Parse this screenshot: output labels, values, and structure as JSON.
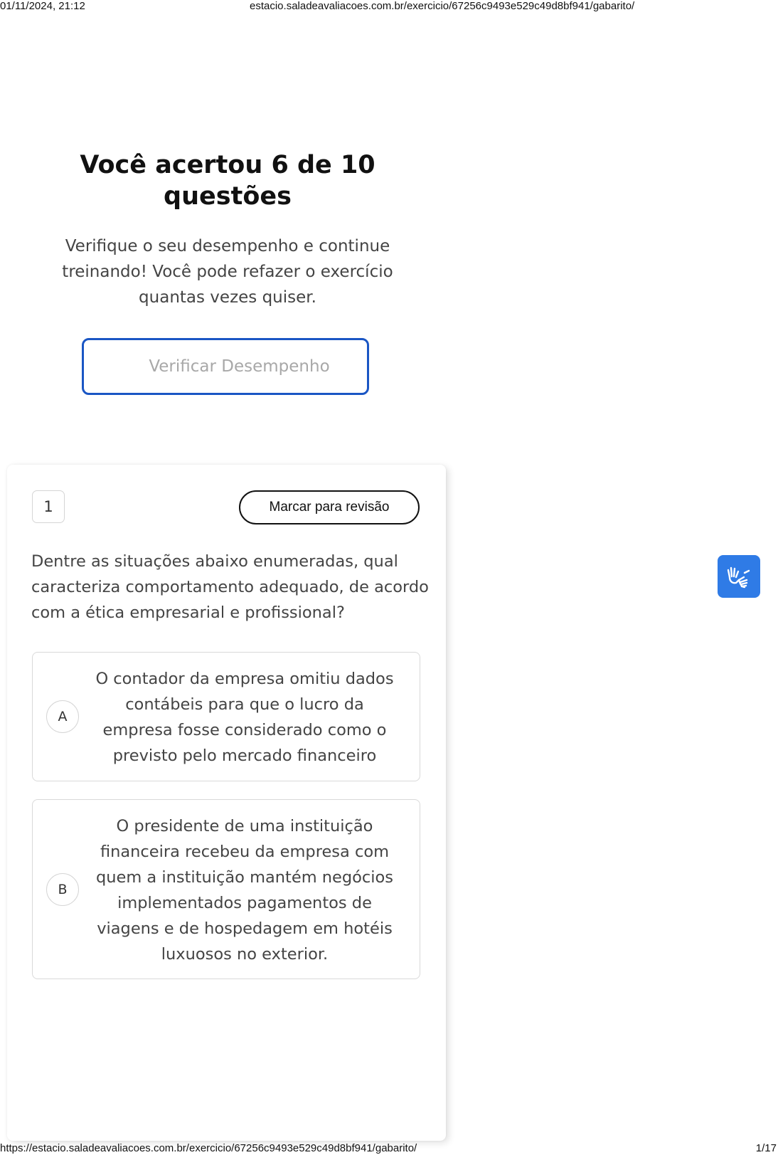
{
  "print": {
    "datetime": "01/11/2024, 21:12",
    "header_url": "estacio.saladeavaliacoes.com.br/exercicio/67256c9493e529c49d8bf941/gabarito/",
    "footer_url": "https://estacio.saladeavaliacoes.com.br/exercicio/67256c9493e529c49d8bf941/gabarito/",
    "page": "1/17"
  },
  "result": {
    "title": "Você acertou 6 de 10 questões",
    "subtitle": "Verifique o seu desempenho e continue treinando! Você pode refazer o exercício quantas vezes quiser.",
    "verify_button": "Verificar Desempenho"
  },
  "question": {
    "number": "1",
    "review_button": "Marcar para revisão",
    "text": "Dentre as situações abaixo enumeradas, qual caracteriza comportamento adequado, de acordo com a ética empresarial e profissional?",
    "options": [
      {
        "letter": "A",
        "text": "O contador da empresa omitiu dados contábeis para que o lucro da empresa fosse considerado como o previsto pelo mercado financeiro"
      },
      {
        "letter": "B",
        "text": "O presidente de uma instituição financeira recebeu da empresa com quem a instituição mantém negócios implementados pagamentos de viagens e de hospedagem em hotéis luxuosos no exterior."
      }
    ]
  },
  "accessibility": {
    "icon": "sign-language-icon",
    "color": "#2f7be6"
  },
  "colors": {
    "accent_border": "#1a56c4",
    "text": "#444444"
  }
}
